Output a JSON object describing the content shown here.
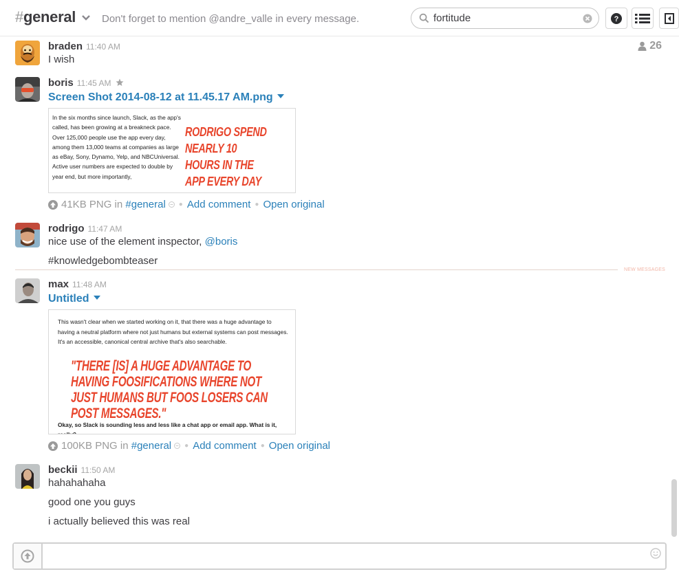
{
  "header": {
    "hash": "#",
    "channel": "general",
    "topic": "Don't forget to mention @andre_valle in every message.",
    "search_value": "fortitude"
  },
  "member_count": "26",
  "messages": [
    {
      "user": "braden",
      "time": "11:40 AM",
      "lines": [
        "I wish"
      ]
    },
    {
      "user": "boris",
      "time": "11:45 AM",
      "file": {
        "title": "Screen Shot 2014-08-12 at 11.45.17 AM.png",
        "thumb_text": "In the six months since launch, Slack, as the app's called, has been growing at a breakneck pace. Over 125,000 people use the app every day, among them 13,000 teams at companies as large as eBay, Sony, Dynamo, Yelp, and NBCUniversal. Active user numbers are expected to double by year end, but more importantly,",
        "thumb_quote": "RODRIGO SPEND NEARLY 10 HOURS IN THE APP EVERY DAY",
        "size": "41KB PNG",
        "in": "in",
        "channel": "#general",
        "add_comment": "Add comment",
        "open_original": "Open original"
      }
    },
    {
      "user": "rodrigo",
      "time": "11:47 AM",
      "line1": "nice use of the element inspector, ",
      "mention": "@boris",
      "line2": "#knowledgebombteaser"
    },
    {
      "user": "max",
      "time": "11:48 AM",
      "file": {
        "title": "Untitled",
        "thumb_top": "This wasn't clear when we started working on it, that there was a huge advantage to having a neutral platform where not just humans but external systems can post messages. It's an accessible, canonical central archive that's also searchable.",
        "thumb_quote": "\"THERE [IS] A HUGE ADVANTAGE TO HAVING FOOSIFICATIONS WHERE NOT JUST HUMANS BUT FOOS LOSERS CAN POST MESSAGES.\"",
        "thumb_bottom": "Okay, so Slack is sounding less and less like a chat app or email app. What is it, really?",
        "size": "100KB PNG",
        "in": "in",
        "channel": "#general",
        "add_comment": "Add comment",
        "open_original": "Open original"
      }
    },
    {
      "user": "beckii",
      "time": "11:50 AM",
      "lines": [
        "hahahahaha",
        "good one you guys",
        "i actually believed this was real"
      ]
    }
  ],
  "divider_label": "NEW MESSAGES",
  "composer": {
    "placeholder": ""
  },
  "colors": {
    "link": "#2a80b9",
    "accent_red": "#e8452c"
  }
}
